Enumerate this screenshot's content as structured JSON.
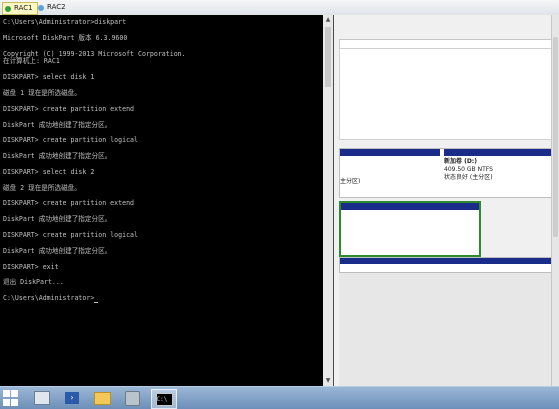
{
  "tabs": [
    {
      "label": "RAC1",
      "active": true
    },
    {
      "label": "RAC2",
      "active": false
    }
  ],
  "console": {
    "lines": [
      "C:\\Users\\Administrator>diskpart",
      "",
      "Microsoft DiskPart 版本 6.3.9600",
      "",
      "Copyright (C) 1999-2013 Microsoft Corporation.",
      "在计算机上: RAC1",
      "",
      "DISKPART> select disk 1",
      "",
      "磁盘 1 现在是所选磁盘。",
      "",
      "DISKPART> create partition extend",
      "",
      "DiskPart 成功地创建了指定分区。",
      "",
      "DISKPART> create partition logical",
      "",
      "DiskPart 成功地创建了指定分区。",
      "",
      "DISKPART> select disk 2",
      "",
      "磁盘 2 现在是所选磁盘。",
      "",
      "DISKPART> create partition extend",
      "",
      "DiskPart 成功地创建了指定分区。",
      "",
      "DISKPART> create partition logical",
      "",
      "DiskPart 成功地创建了指定分区。",
      "",
      "DISKPART> exit",
      "",
      "退出 DiskPart...",
      "",
      "C:\\Users\\Administrator>"
    ]
  },
  "disk_management": {
    "volume_name": "新加卷  (D:)",
    "volume_size": "409.50 GB NTFS",
    "volume_status": "状态良好 (主分区)",
    "partition_fragment": "主分区)"
  },
  "taskbar": {
    "items": [
      "start",
      "server-manager",
      "powershell",
      "file-explorer",
      "tools",
      "command-prompt"
    ],
    "active": "command-prompt"
  },
  "colors": {
    "console_bg": "#000000",
    "console_text": "#c0c0c0",
    "partition_bar": "#1a2c8a",
    "selected_border": "#2d8a2d"
  }
}
